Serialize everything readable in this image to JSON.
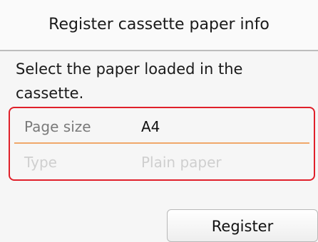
{
  "header": {
    "title": "Register cassette paper info"
  },
  "message": "Select the paper loaded in the cassette.",
  "settings": {
    "page_size": {
      "label": "Page size",
      "value": "A4"
    },
    "type": {
      "label": "Type",
      "value": "Plain paper"
    }
  },
  "actions": {
    "register_label": "Register"
  },
  "colors": {
    "highlight_border": "#e0202a",
    "divider": "#f0a86a"
  }
}
